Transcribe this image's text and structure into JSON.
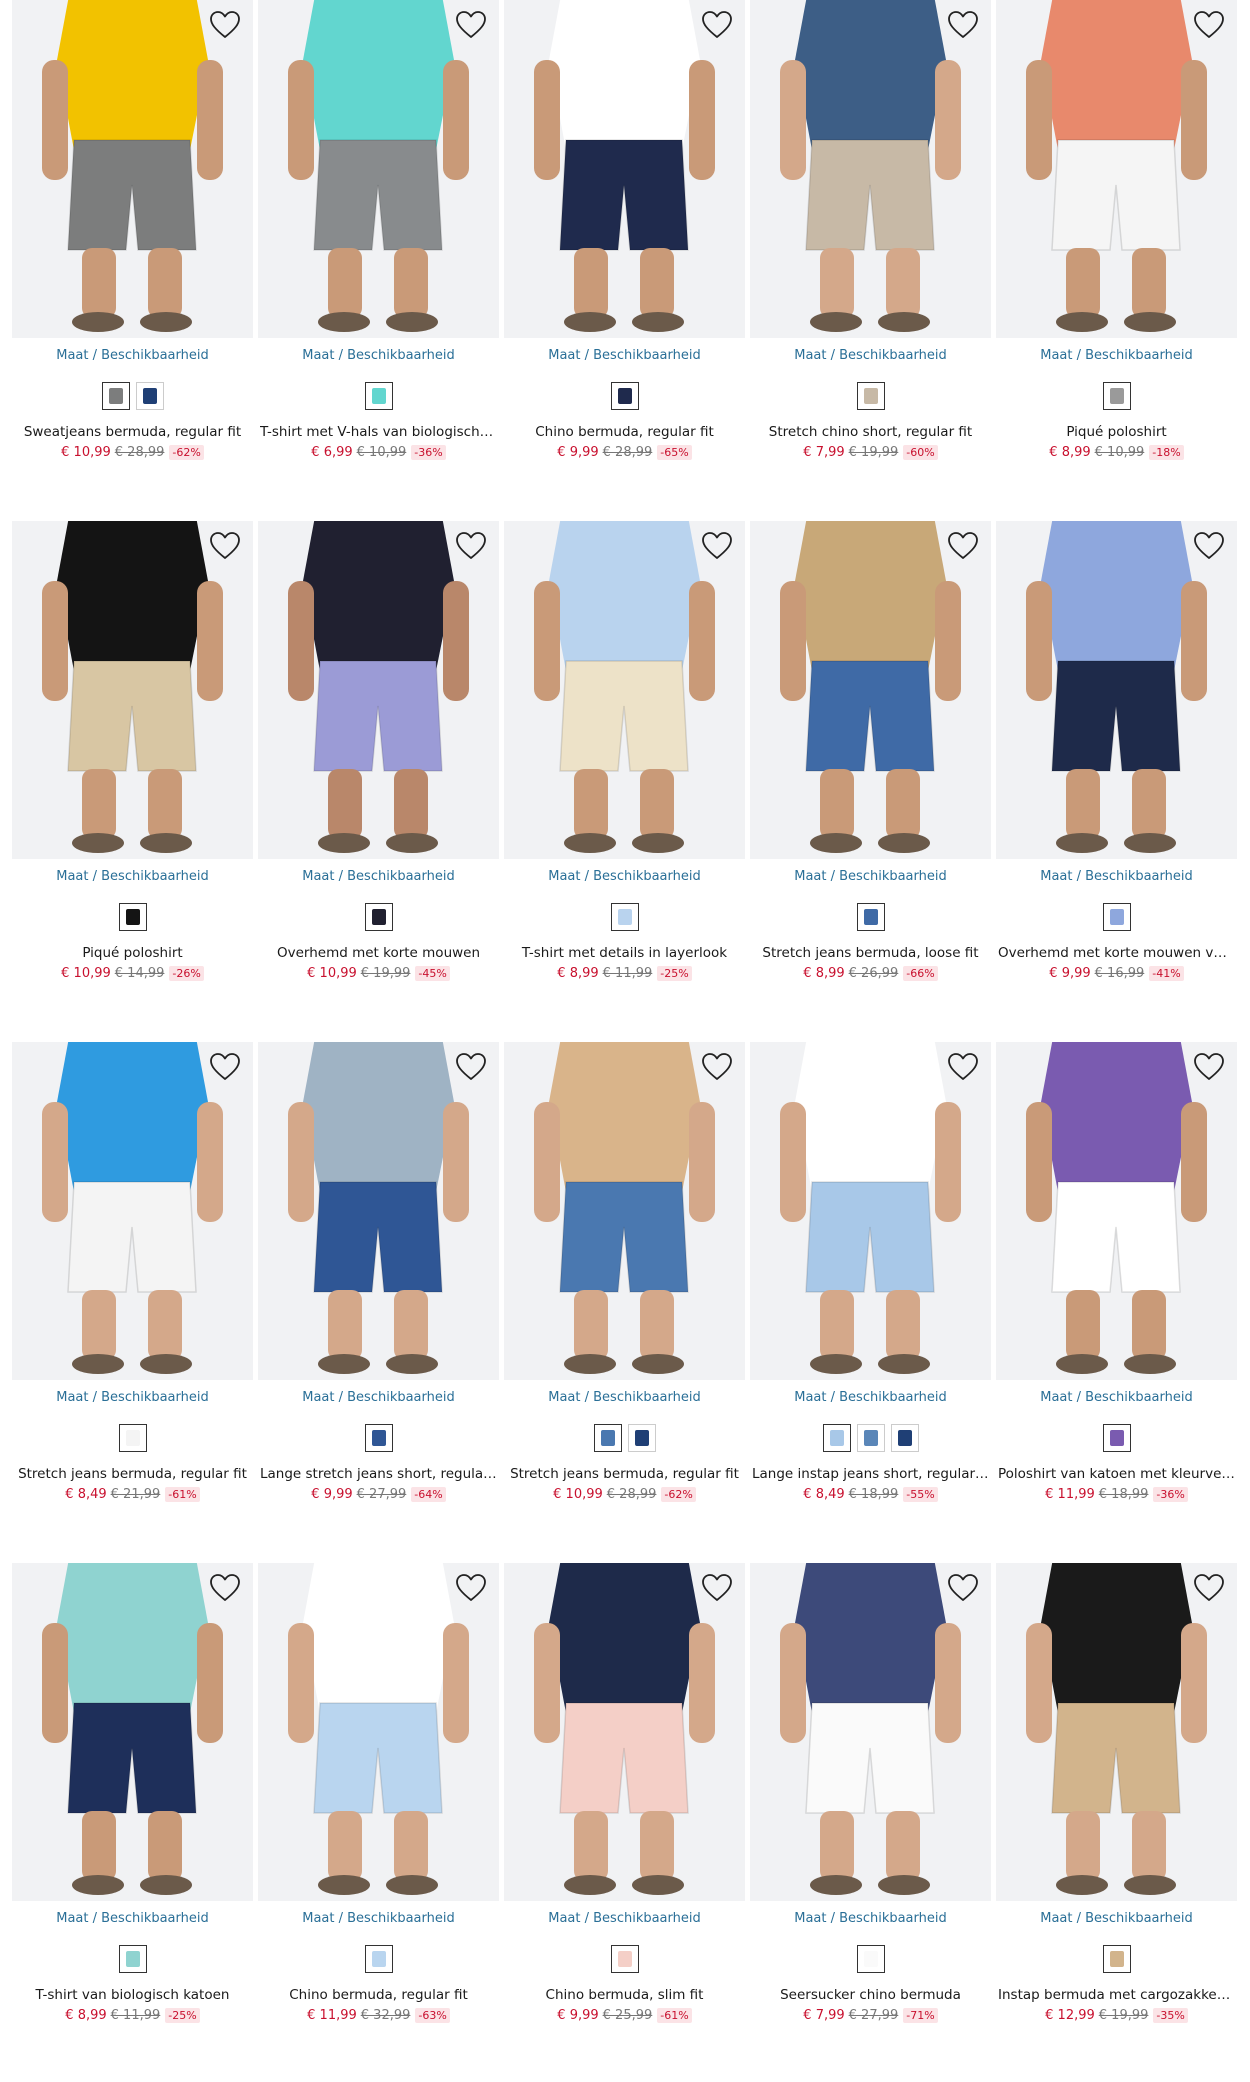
{
  "labels": {
    "size_availability": "Maat / Beschikbaarheid"
  },
  "icons": {
    "wishlist": "heart-outline-icon"
  },
  "colors": {
    "link": "#2a6f97",
    "sale_price": "#c8102e",
    "discount_bg": "#fbe3e6",
    "old_price": "#777777"
  },
  "products": [
    {
      "name": "Sweatjeans bermuda, regular fit",
      "price": "€ 10,99",
      "old_price": "€ 28,99",
      "discount": "-62%",
      "top": "#f2c200",
      "bottom": "#7c7d7d",
      "skin": "#c99a78",
      "swatches": [
        "#7c7d7d",
        "#1f3f75"
      ]
    },
    {
      "name": "T-shirt met V-hals van biologisch katoen",
      "price": "€ 6,99",
      "old_price": "€ 10,99",
      "discount": "-36%",
      "top": "#62d6cf",
      "bottom": "#888b8d",
      "skin": "#c99a78",
      "swatches": [
        "#62d6cf"
      ]
    },
    {
      "name": "Chino bermuda, regular fit",
      "price": "€ 9,99",
      "old_price": "€ 28,99",
      "discount": "-65%",
      "top": "#ffffff",
      "bottom": "#1f2a4d",
      "skin": "#c99a78",
      "swatches": [
        "#1f2a4d"
      ]
    },
    {
      "name": "Stretch chino short, regular fit",
      "price": "€ 7,99",
      "old_price": "€ 19,99",
      "discount": "-60%",
      "top": "#3d5e86",
      "bottom": "#c7b9a6",
      "skin": "#d4a88a",
      "swatches": [
        "#c7b9a6"
      ]
    },
    {
      "name": "Piqué poloshirt",
      "price": "€ 8,99",
      "old_price": "€ 10,99",
      "discount": "-18%",
      "top": "#e8896c",
      "bottom": "#f5f5f5",
      "skin": "#c99a78",
      "swatches": [
        "#9a9a9a"
      ]
    },
    {
      "name": "Piqué poloshirt",
      "price": "€ 10,99",
      "old_price": "€ 14,99",
      "discount": "-26%",
      "top": "#141414",
      "bottom": "#d8c6a3",
      "skin": "#c99a78",
      "swatches": [
        "#141414"
      ]
    },
    {
      "name": "Overhemd met korte mouwen",
      "price": "€ 10,99",
      "old_price": "€ 19,99",
      "discount": "-45%",
      "top": "#202030",
      "bottom": "#9b9bd6",
      "skin": "#b9876a",
      "swatches": [
        "#202030"
      ]
    },
    {
      "name": "T-shirt met details in layerlook",
      "price": "€ 8,99",
      "old_price": "€ 11,99",
      "discount": "-25%",
      "top": "#b9d3ee",
      "bottom": "#ede2c8",
      "skin": "#c99a78",
      "swatches": [
        "#b9d3ee"
      ]
    },
    {
      "name": "Stretch jeans bermuda, loose fit",
      "price": "€ 8,99",
      "old_price": "€ 26,99",
      "discount": "-66%",
      "top": "#c8a878",
      "bottom": "#3f6aa6",
      "skin": "#c99a78",
      "swatches": [
        "#3f6aa6"
      ]
    },
    {
      "name": "Overhemd met korte mouwen van linnen look",
      "price": "€ 9,99",
      "old_price": "€ 16,99",
      "discount": "-41%",
      "top": "#8ea7dd",
      "bottom": "#1e2a4a",
      "skin": "#c99a78",
      "swatches": [
        "#8ea7dd"
      ]
    },
    {
      "name": "Stretch jeans bermuda, regular fit",
      "price": "€ 8,49",
      "old_price": "€ 21,99",
      "discount": "-61%",
      "top": "#2f9be0",
      "bottom": "#f4f4f4",
      "skin": "#d4a88a",
      "swatches": [
        "#f4f4f4"
      ]
    },
    {
      "name": "Lange stretch jeans short, regular fit",
      "price": "€ 9,99",
      "old_price": "€ 27,99",
      "discount": "-64%",
      "top": "#9fb3c4",
      "bottom": "#2f5695",
      "skin": "#d4a88a",
      "swatches": [
        "#2f5695"
      ]
    },
    {
      "name": "Stretch jeans bermuda, regular fit",
      "price": "€ 10,99",
      "old_price": "€ 28,99",
      "discount": "-62%",
      "top": "#d9b48a",
      "bottom": "#4a78b0",
      "skin": "#d4a88a",
      "swatches": [
        "#4a78b0",
        "#1f3f75"
      ]
    },
    {
      "name": "Lange instap jeans short, regular fit",
      "price": "€ 8,49",
      "old_price": "€ 18,99",
      "discount": "-55%",
      "top": "#ffffff",
      "bottom": "#a8c8e8",
      "skin": "#d4a88a",
      "swatches": [
        "#a8c8e8",
        "#5a86b8",
        "#1f3f75"
      ]
    },
    {
      "name": "Poloshirt van katoen met kleurverloop",
      "price": "€ 11,99",
      "old_price": "€ 18,99",
      "discount": "-36%",
      "top": "#7a5bb0",
      "bottom": "#ffffff",
      "skin": "#c99a78",
      "swatches": [
        "#7a5bb0"
      ]
    },
    {
      "name": "T-shirt van biologisch katoen",
      "price": "€ 8,99",
      "old_price": "€ 11,99",
      "discount": "-25%",
      "top": "#8fd3d0",
      "bottom": "#1e2f5a",
      "skin": "#c99a78",
      "swatches": [
        "#8fd3d0"
      ]
    },
    {
      "name": "Chino bermuda, regular fit",
      "price": "€ 11,99",
      "old_price": "€ 32,99",
      "discount": "-63%",
      "top": "#ffffff",
      "bottom": "#b9d5ef",
      "skin": "#d4a88a",
      "swatches": [
        "#b9d5ef"
      ]
    },
    {
      "name": "Chino bermuda, slim fit",
      "price": "€ 9,99",
      "old_price": "€ 25,99",
      "discount": "-61%",
      "top": "#1e2a4a",
      "bottom": "#f4cfc7",
      "skin": "#d4a88a",
      "swatches": [
        "#f4cfc7"
      ]
    },
    {
      "name": "Seersucker chino bermuda",
      "price": "€ 7,99",
      "old_price": "€ 27,99",
      "discount": "-71%",
      "top": "#3d4a7a",
      "bottom": "#fafafa",
      "skin": "#d4a88a",
      "swatches": [
        "#fafafa"
      ]
    },
    {
      "name": "Instap bermuda met cargozakken, regular fit",
      "price": "€ 12,99",
      "old_price": "€ 19,99",
      "discount": "-35%",
      "top": "#1a1a1a",
      "bottom": "#d2b48c",
      "skin": "#d4a88a",
      "swatches": [
        "#d2b48c"
      ]
    }
  ]
}
